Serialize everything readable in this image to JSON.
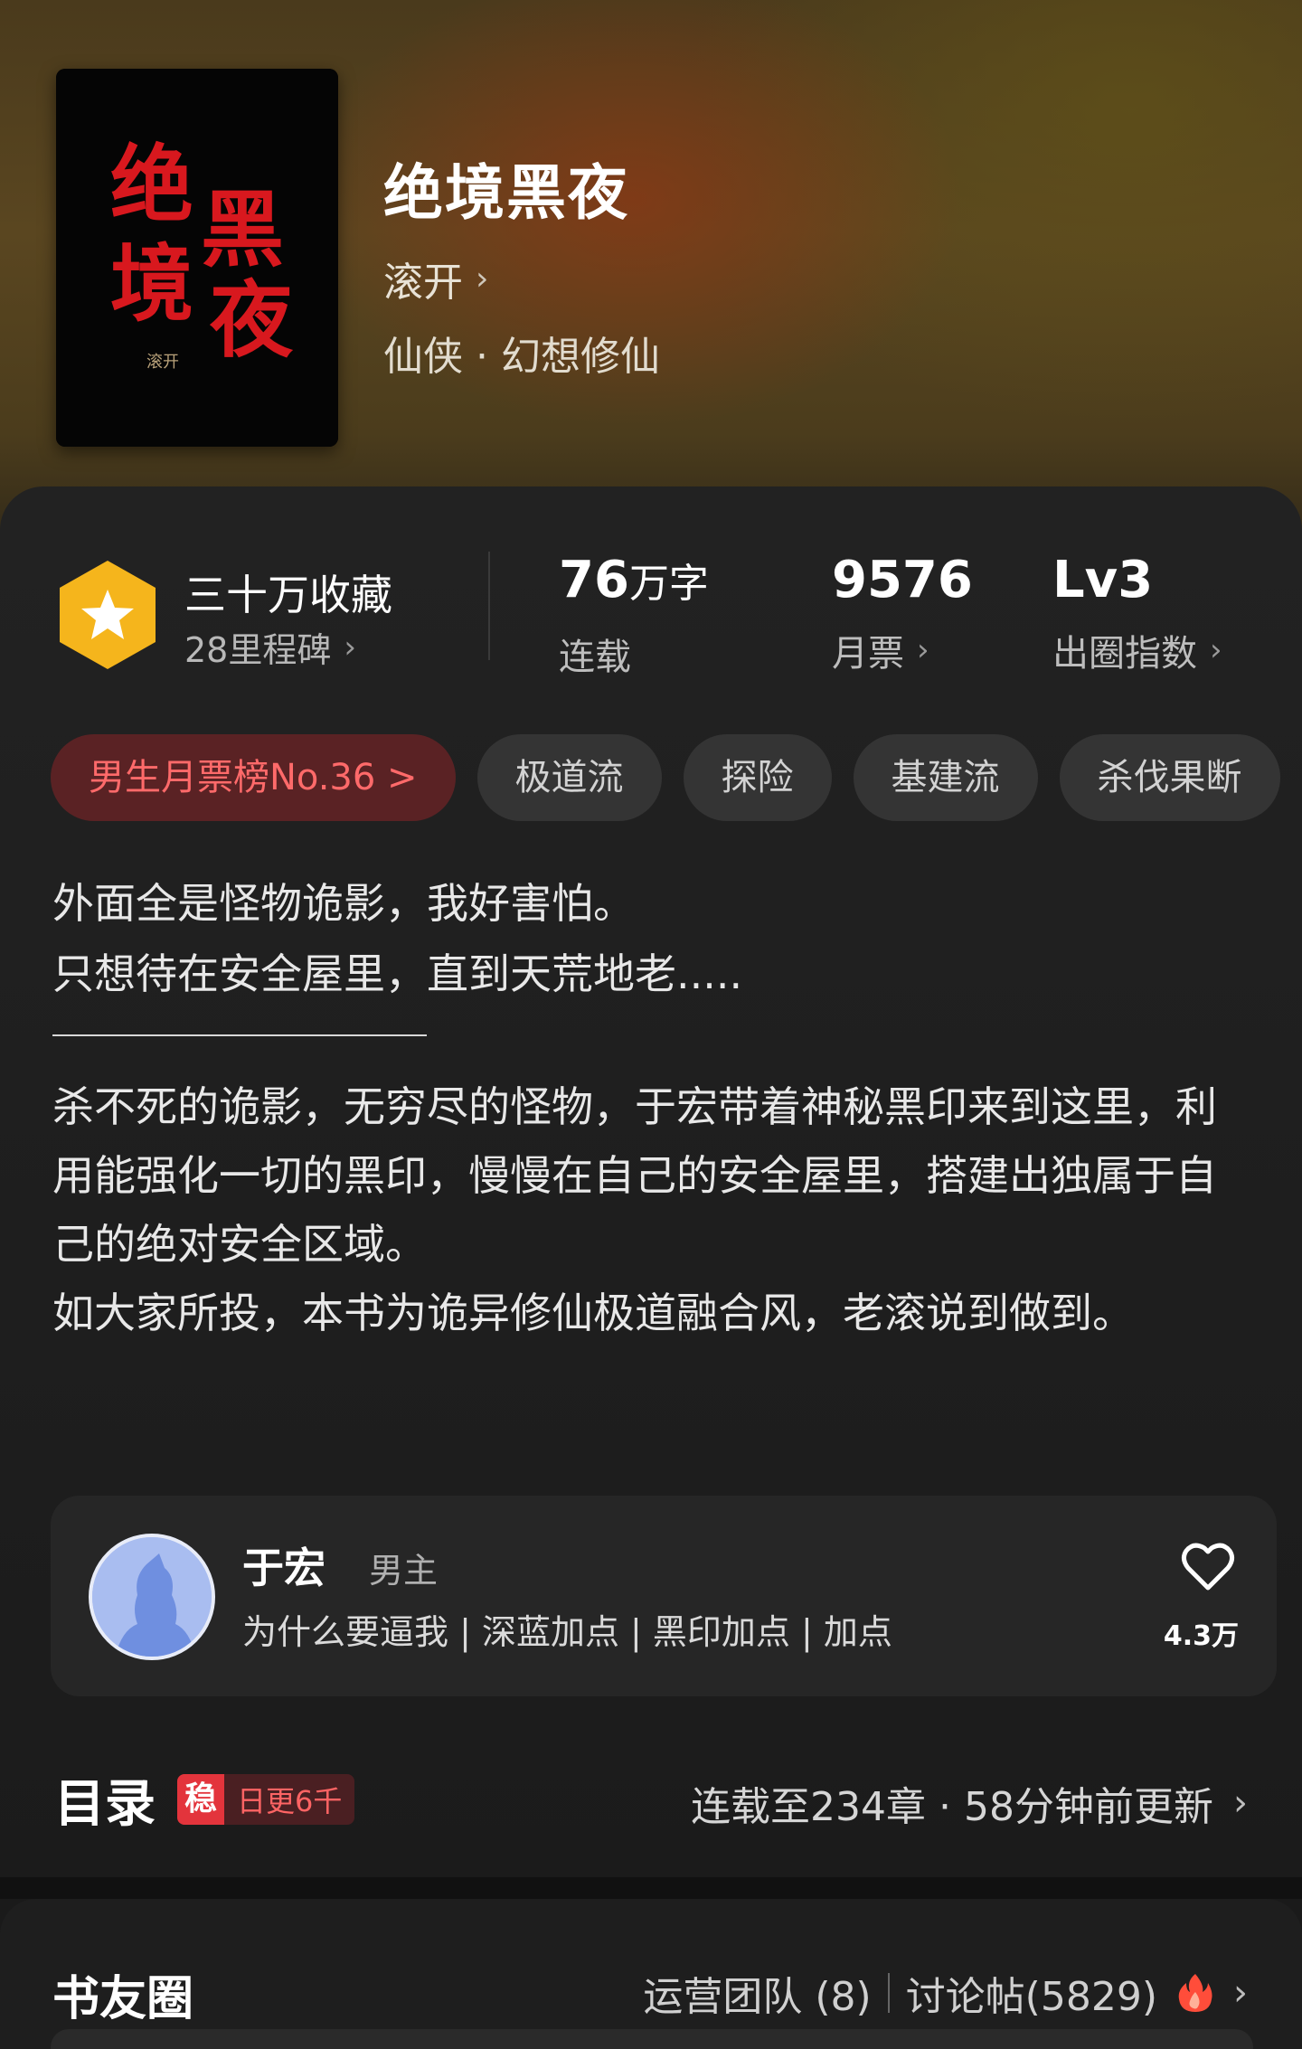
{
  "book": {
    "title": "绝境黑夜",
    "author": "滚开",
    "genre": "仙侠 · 幻想修仙",
    "cover_text": [
      "绝",
      "境",
      "黑",
      "夜"
    ],
    "cover_author": "滚开"
  },
  "stats": {
    "favorites_title": "三十万收藏",
    "milestones": "28里程碑",
    "words_value": "76",
    "words_unit": "万字",
    "words_label": "连载",
    "tickets_value": "9576",
    "tickets_label": "月票",
    "level_value": "Lv3",
    "level_label": "出圈指数"
  },
  "tags": [
    "男生月票榜No.36 >",
    "极道流",
    "探险",
    "基建流",
    "杀伐果断"
  ],
  "intro": {
    "line1": "外面全是怪物诡影，我好害怕。",
    "line2": "只想待在安全屋里，直到天荒地老....."
  },
  "description": {
    "para1": "杀不死的诡影，无穷尽的怪物，于宏带着神秘黑印来到这里，利用能强化一切的黑印，慢慢在自己的安全屋里，搭建出独属于自己的绝对安全区域。",
    "para2": "如大家所投，本书为诡异修仙极道融合风，老滚说到做到。"
  },
  "character": {
    "name": "于宏",
    "role": "男主",
    "tags": "为什么要逼我 | 深蓝加点 | 黑印加点 | 加点",
    "likes": "4.3万"
  },
  "toc": {
    "title": "目录",
    "badge_icon": "稳",
    "badge_text": "日更6千",
    "info": "连载至234章 · 58分钟前更新"
  },
  "community": {
    "title": "书友圈",
    "team": "运营团队 (8)",
    "posts": "讨论帖(5829)"
  },
  "colors": {
    "accent_red": "#e3343c",
    "badge_gold": "#f5b51c",
    "background": "#1a1a1a"
  },
  "icons": {
    "chevron": "chevron-right-icon",
    "star": "star-icon",
    "heart": "heart-icon",
    "fire": "fire-icon"
  }
}
